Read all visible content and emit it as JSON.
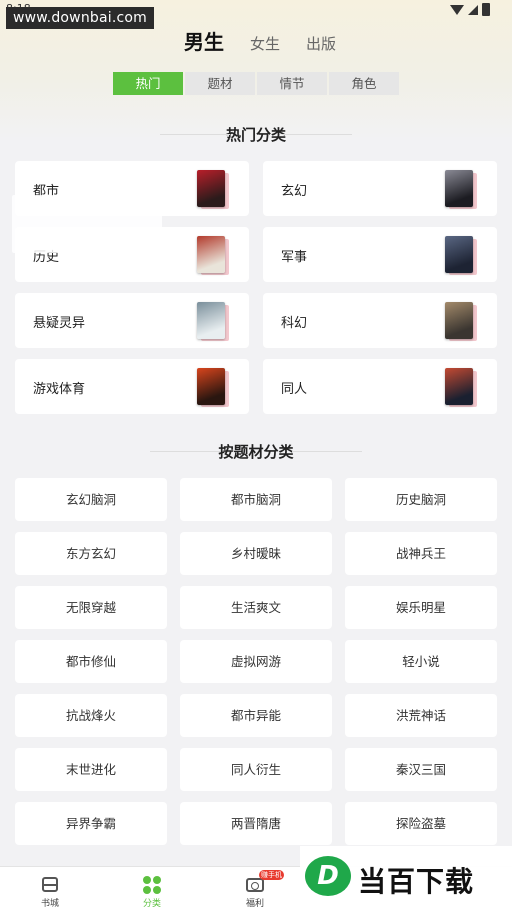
{
  "watermark_text": "www.downbai.com",
  "status": {
    "time": "8:18"
  },
  "top_tabs": [
    {
      "label": "男生",
      "active": true
    },
    {
      "label": "女生",
      "active": false
    },
    {
      "label": "出版",
      "active": false
    }
  ],
  "sub_tabs": [
    {
      "label": "热门",
      "active": true
    },
    {
      "label": "题材",
      "active": false
    },
    {
      "label": "情节",
      "active": false
    },
    {
      "label": "角色",
      "active": false
    }
  ],
  "hot_section": {
    "title": "热门分类"
  },
  "hot_categories": [
    {
      "label": "都市",
      "cover_colors": [
        "#2b1b1b",
        "#b81f2a"
      ]
    },
    {
      "label": "玄幻",
      "cover_colors": [
        "#1c1c22",
        "#8a8a95"
      ]
    },
    {
      "label": "历史",
      "cover_colors": [
        "#e9e4da",
        "#b23a2c"
      ]
    },
    {
      "label": "军事",
      "cover_colors": [
        "#1d2333",
        "#5a6783"
      ]
    },
    {
      "label": "悬疑灵异",
      "cover_colors": [
        "#e8eef0",
        "#7a8f9b"
      ]
    },
    {
      "label": "科幻",
      "cover_colors": [
        "#3a3530",
        "#a38a6a"
      ]
    },
    {
      "label": "游戏体育",
      "cover_colors": [
        "#2a1610",
        "#d8451d"
      ]
    },
    {
      "label": "同人",
      "cover_colors": [
        "#1a2030",
        "#c44a32"
      ]
    }
  ],
  "topic_section": {
    "title": "按题材分类"
  },
  "topics": [
    "玄幻脑洞",
    "都市脑洞",
    "历史脑洞",
    "东方玄幻",
    "乡村暧昧",
    "战神兵王",
    "无限穿越",
    "生活爽文",
    "娱乐明星",
    "都市修仙",
    "虚拟网游",
    "轻小说",
    "抗战烽火",
    "都市异能",
    "洪荒神话",
    "末世进化",
    "同人衍生",
    "秦汉三国",
    "异界争霸",
    "两晋隋唐",
    "探险盗墓"
  ],
  "bottom_nav": {
    "items": [
      {
        "label": "书城",
        "icon": "bookshelf-icon"
      },
      {
        "label": "分类",
        "icon": "category-icon"
      },
      {
        "label": "福利",
        "icon": "welfare-icon"
      }
    ],
    "welfare_badge": "赚手机"
  },
  "ad_overlay": {
    "letter": "D",
    "text": "当百下载"
  },
  "colors": {
    "accent": "#5cc03f",
    "badge": "#e83a2f",
    "background": "#f2f2f4"
  }
}
